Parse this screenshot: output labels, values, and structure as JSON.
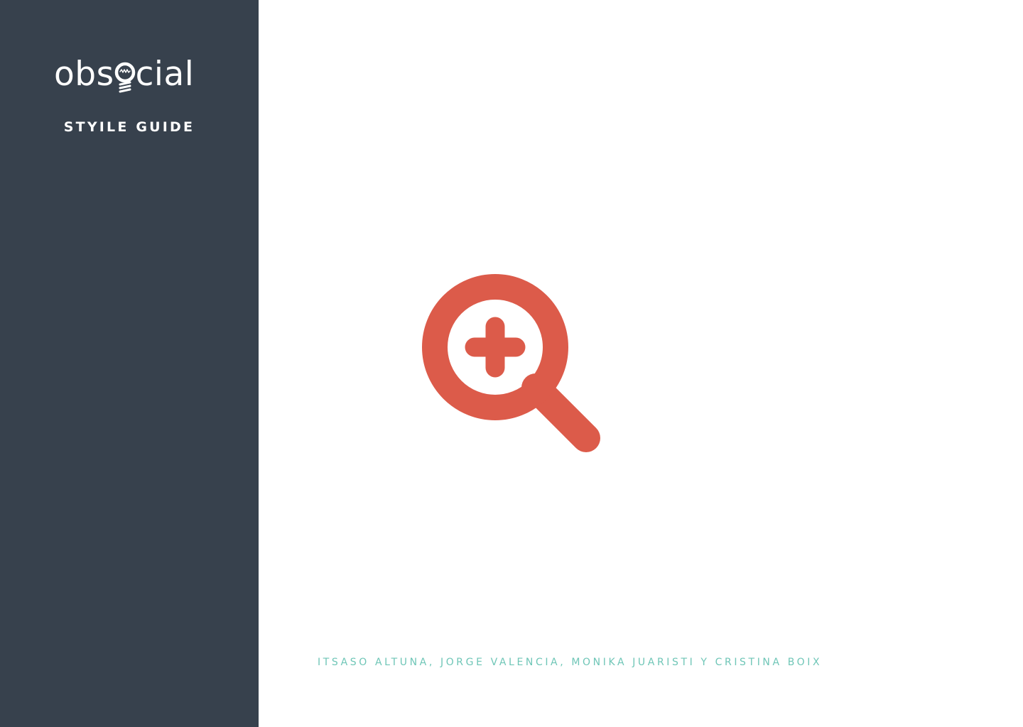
{
  "sidebar": {
    "logo": {
      "text_start": "obs",
      "text_end": "cial",
      "icon": "lightbulb-icon"
    },
    "subtitle": "STYILE GUIDE"
  },
  "main": {
    "icon": "zoom-in-icon",
    "authors": "ITSASO ALTUNA, JORGE VALENCIA, MONIKA JUARISTI Y CRISTINA BOIX"
  },
  "colors": {
    "sidebar_bg": "#37414d",
    "accent": "#dc5b4a",
    "authors_text": "#6fc6b7"
  }
}
